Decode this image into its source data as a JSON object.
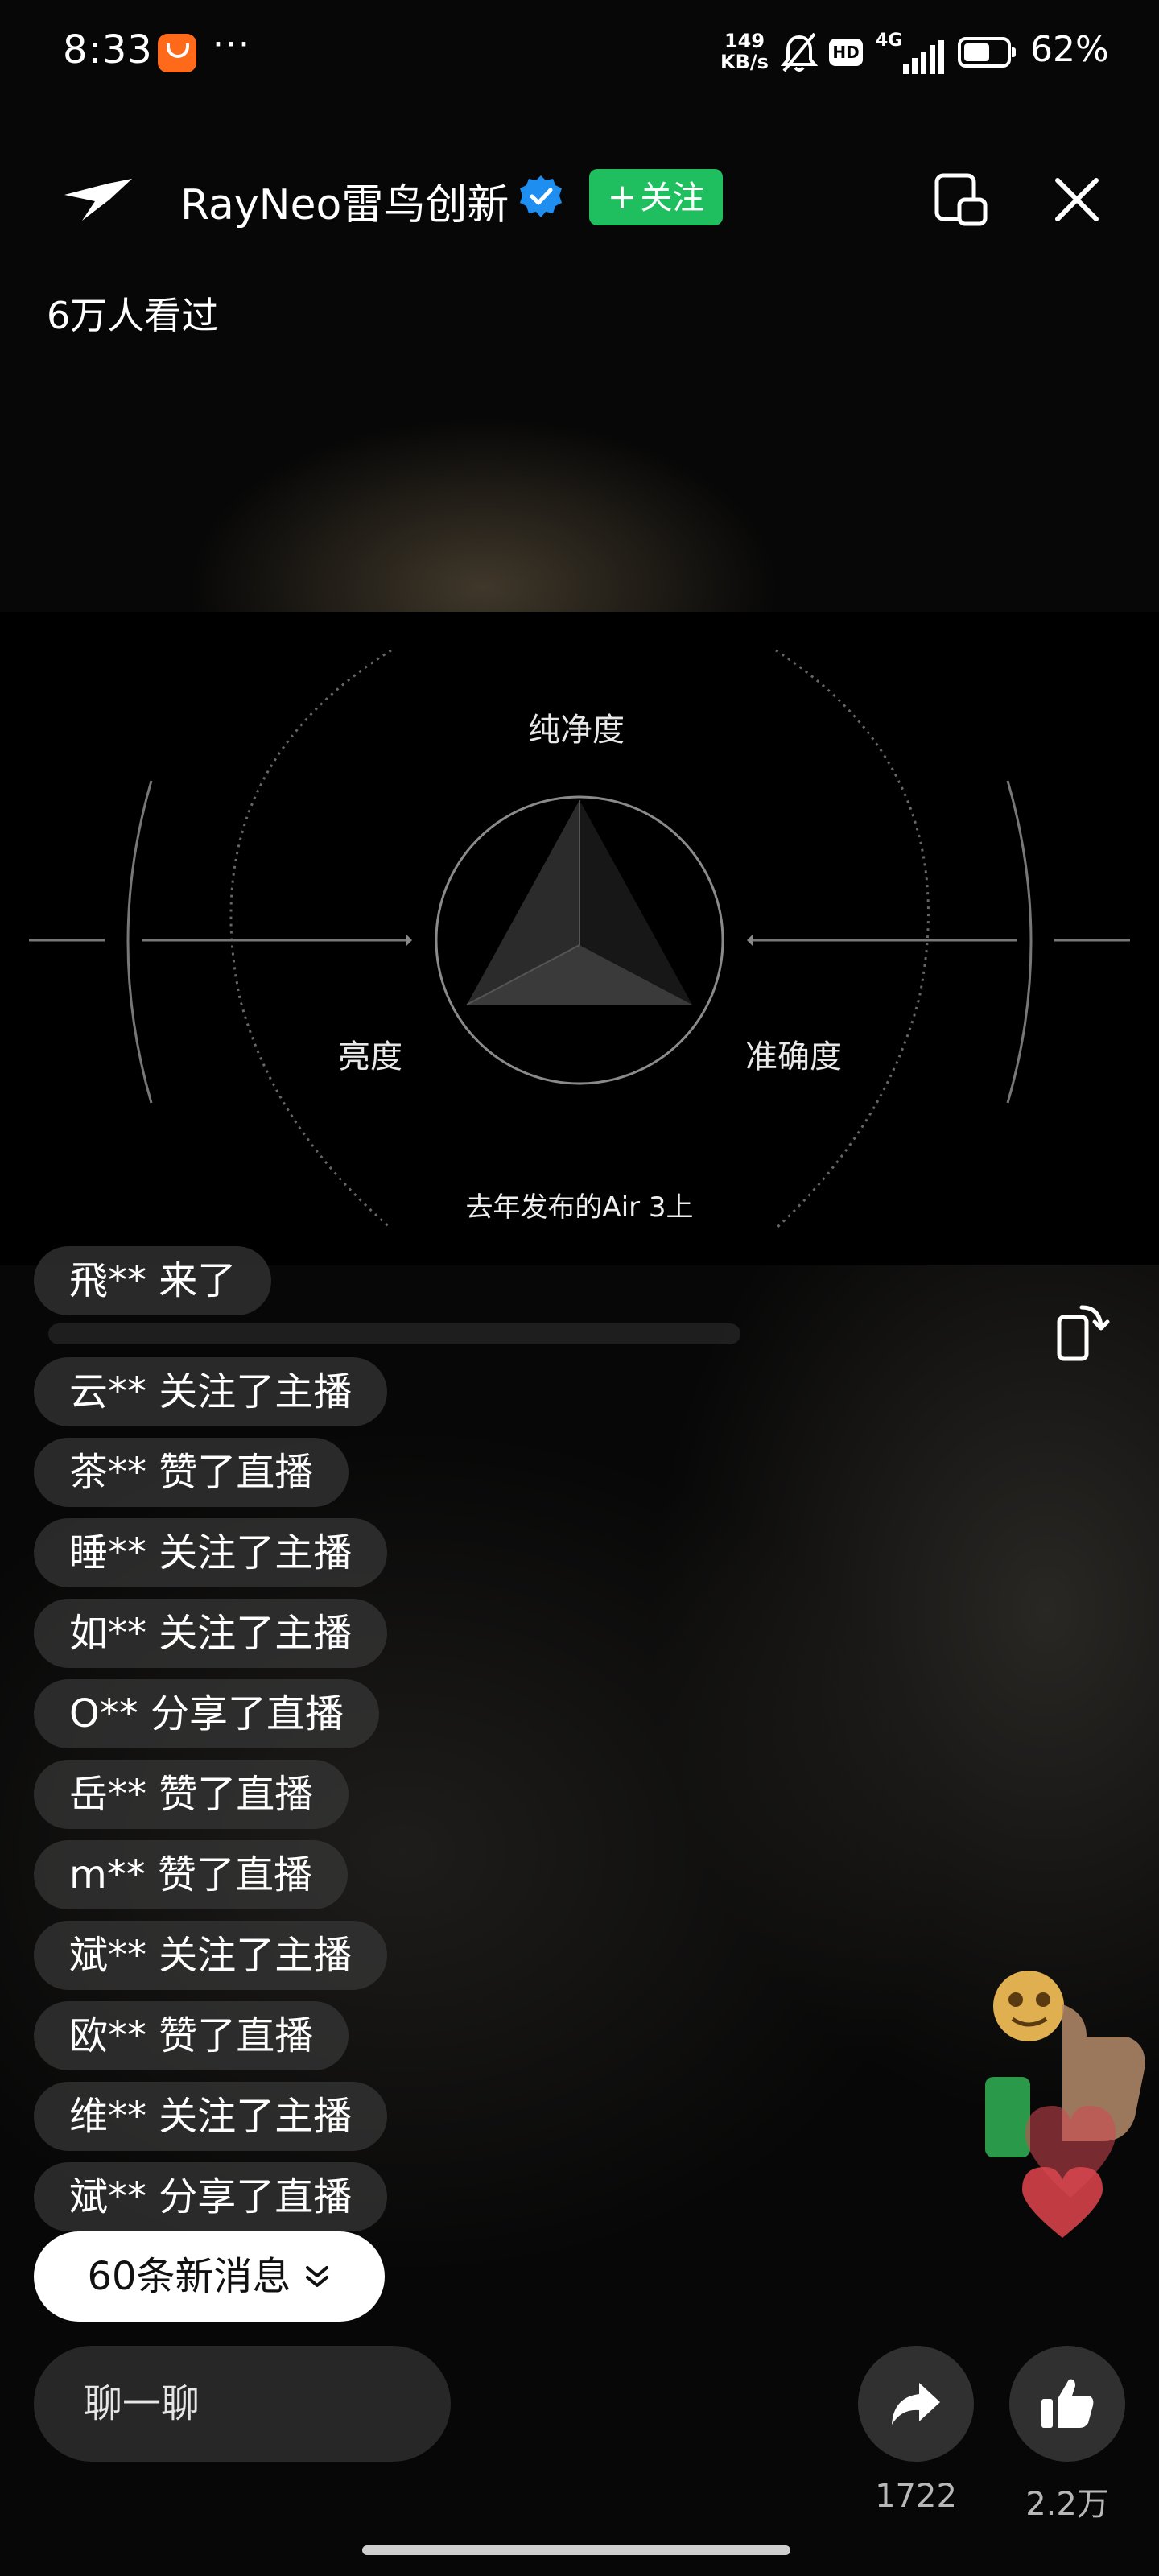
{
  "status_bar": {
    "time": "8:33",
    "more": "···",
    "net_speed": "149\nKB/s",
    "net_speed_top": "149",
    "net_speed_bottom": "KB/s",
    "hd": "HD",
    "network": "4G",
    "battery_text": "62%",
    "battery_level": 0.62
  },
  "header": {
    "channel_name": "RayNeo雷鸟创新",
    "follow_label": "关注",
    "viewers": "6万人看过"
  },
  "video": {
    "label_top": "纯净度",
    "label_left": "亮度",
    "label_right": "准确度",
    "caption": "去年发布的Air 3上"
  },
  "messages": [
    "飛** 来了",
    "云** 关注了主播",
    "茶** 赞了直播",
    "睡** 关注了主播",
    "如** 关注了主播",
    "O** 分享了直播",
    "岳** 赞了直播",
    "m** 赞了直播",
    "斌** 关注了主播",
    "欧** 赞了直播",
    "维** 关注了主播",
    "斌** 分享了直播"
  ],
  "new_messages_label": "60条新消息",
  "chat_placeholder": "聊一聊",
  "share_count": "1722",
  "like_count": "2.2万",
  "colors": {
    "follow_button": "#1fbf5f",
    "verified_badge": "#1e8ff0",
    "app_icon": "#ff6a1a"
  },
  "icons": [
    "app-icon",
    "more-dots-icon",
    "mute-bell-icon",
    "hd-icon",
    "signal-icon",
    "battery-icon",
    "logo-icon",
    "verified-icon",
    "mini-window-icon",
    "close-icon",
    "rotate-screen-icon",
    "chevron-down-icon",
    "share-icon",
    "thumbs-up-icon"
  ]
}
